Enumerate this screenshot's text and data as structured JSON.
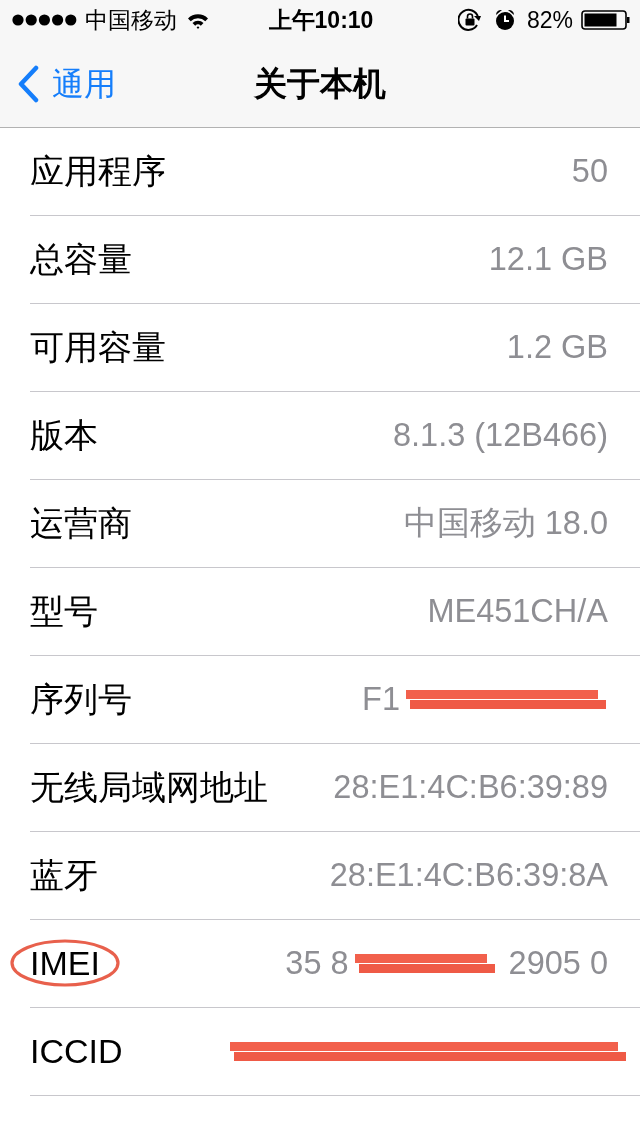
{
  "status_bar": {
    "carrier": "中国移动",
    "time": "上午10:10",
    "battery_percent": "82%"
  },
  "nav_bar": {
    "back_label": "通用",
    "title": "关于本机"
  },
  "rows": [
    {
      "label": "应用程序",
      "value": "50",
      "redacted": false,
      "circled": false
    },
    {
      "label": "总容量",
      "value": "12.1 GB",
      "redacted": false,
      "circled": false
    },
    {
      "label": "可用容量",
      "value": "1.2 GB",
      "redacted": false,
      "circled": false
    },
    {
      "label": "版本",
      "value": "8.1.3 (12B466)",
      "redacted": false,
      "circled": false
    },
    {
      "label": "运营商",
      "value": "中国移动 18.0",
      "redacted": false,
      "circled": false
    },
    {
      "label": "型号",
      "value": "ME451CH/A",
      "redacted": false,
      "circled": false
    },
    {
      "label": "序列号",
      "value": "F1",
      "redacted": true,
      "circled": false
    },
    {
      "label": "无线局域网地址",
      "value": "28:E1:4C:B6:39:89",
      "redacted": false,
      "circled": false
    },
    {
      "label": "蓝牙",
      "value": "28:E1:4C:B6:39:8A",
      "redacted": false,
      "circled": false
    },
    {
      "label": "IMEI",
      "value": "35 8",
      "value_tail": "2905 0",
      "redacted": true,
      "circled": true
    },
    {
      "label": "ICCID",
      "redacted": true,
      "circled": false
    }
  ]
}
